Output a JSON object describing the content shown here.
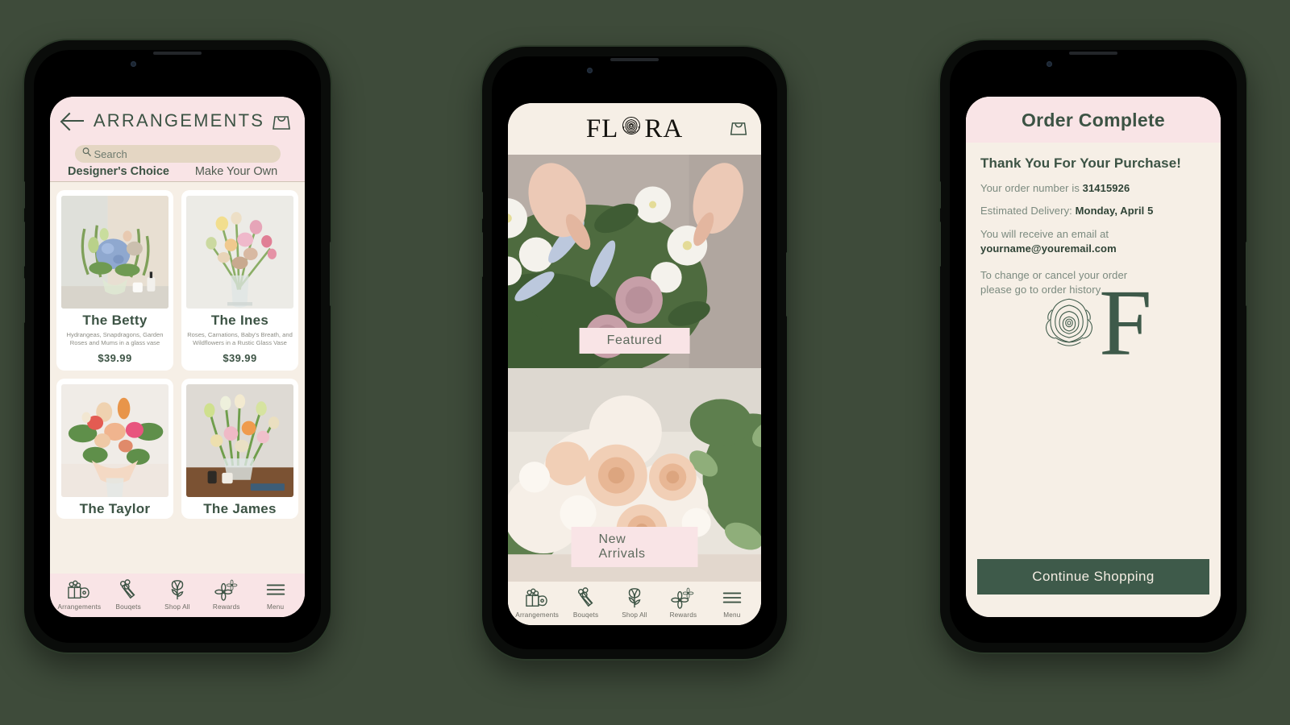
{
  "theme": {
    "page_background": "#3e4b3a",
    "pink": "#f9e4e6",
    "cream": "#f6efe6",
    "green": "#3c5344",
    "button_green": "#3e5a4a",
    "search_tan": "#e4d6c3"
  },
  "brand": {
    "name": "FLORA",
    "monogram": "F"
  },
  "arrangements_screen": {
    "header": {
      "title": "ARRANGEMENTS",
      "back_icon": "back-arrow-icon",
      "bag_icon": "shopping-bag-icon"
    },
    "search": {
      "placeholder": "Search",
      "icon": "search-icon"
    },
    "tabs": [
      {
        "label": "Designer's Choice",
        "active": true
      },
      {
        "label": "Make Your Own",
        "active": false
      }
    ],
    "products": [
      {
        "name": "The Betty",
        "description": "Hydrangeas, Snapdragons, Garden Roses and Mums in a glass vase",
        "price": "$39.99"
      },
      {
        "name": "The Ines",
        "description": "Roses, Carnations, Baby's Breath, and Wildflowers in a Rustic Glass Vase",
        "price": "$39.99"
      },
      {
        "name": "The Taylor",
        "description": "",
        "price": ""
      },
      {
        "name": "The James",
        "description": "",
        "price": ""
      }
    ]
  },
  "home_screen": {
    "logo_text_left": "FL",
    "logo_text_right": "RA",
    "logo_rose_icon": "rose-icon",
    "bag_icon": "shopping-bag-icon",
    "banners": [
      {
        "label": "Featured"
      },
      {
        "label": "New Arrivals"
      }
    ]
  },
  "order_complete_screen": {
    "header_title": "Order Complete",
    "thank_you": "Thank You For Your Purchase!",
    "order_number_label": "Your order number is ",
    "order_number": "31415926",
    "delivery_label": "Estimated Delivery: ",
    "delivery_value": "Monday, April 5",
    "email_label": "You will receive an email at",
    "email_value": "yourname@youremail.com",
    "change_line1": "To change or cancel your order",
    "change_line2": "please go to order history",
    "monogram": "F",
    "rose_icon": "rose-line-art-icon",
    "cta_label": "Continue Shopping"
  },
  "bottom_nav": {
    "items": [
      {
        "label": "Arrangements",
        "icon": "gift-box-flowers-icon"
      },
      {
        "label": "Bouqets",
        "icon": "bouquet-icon"
      },
      {
        "label": "Shop All",
        "icon": "tulip-icon"
      },
      {
        "label": "Rewards",
        "icon": "flowers-icon"
      },
      {
        "label": "Menu",
        "icon": "hamburger-menu-icon"
      }
    ]
  }
}
